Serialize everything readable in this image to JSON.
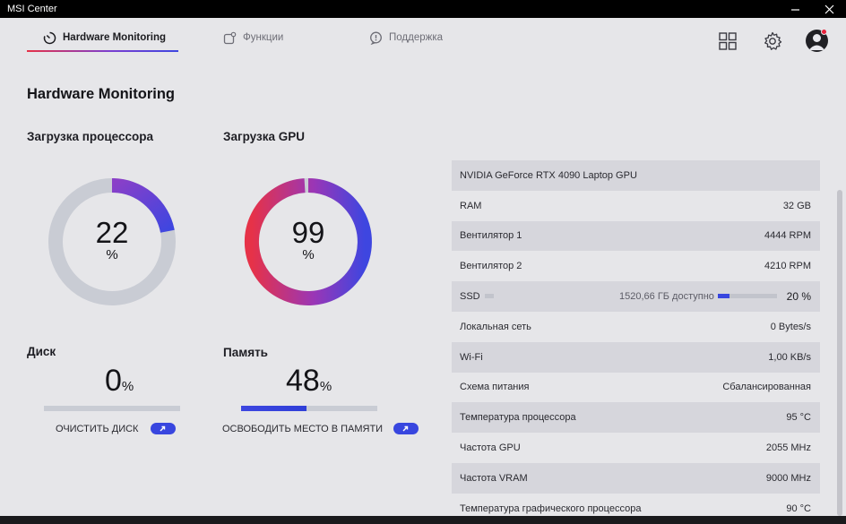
{
  "window": {
    "title": "MSI Center",
    "min_glyph": "—",
    "close_glyph": "✕"
  },
  "nav": {
    "tabs": [
      {
        "label": "Hardware Monitoring",
        "icon": "gauge-icon",
        "active": true
      },
      {
        "label": "Функции",
        "icon": "features-icon",
        "active": false
      },
      {
        "label": "Поддержка",
        "icon": "support-icon",
        "active": false
      }
    ]
  },
  "page": {
    "title": "Hardware Monitoring"
  },
  "cpu": {
    "title": "Загрузка процессора",
    "value": "22",
    "unit": "%",
    "fraction": 0.22
  },
  "gpu": {
    "title": "Загрузка GPU",
    "value": "99",
    "unit": "%",
    "fraction": 0.99
  },
  "disk": {
    "title": "Диск",
    "value": "0",
    "unit": "%",
    "fraction": 0.0,
    "action": "ОЧИСТИТЬ ДИСК"
  },
  "memory": {
    "title": "Память",
    "value": "48",
    "unit": "%",
    "fraction": 0.48,
    "action": "ОСВОБОДИТЬ МЕСТО В ПАМЯТИ"
  },
  "info": {
    "rows": [
      {
        "label": "NVIDIA GeForce RTX 4090 Laptop GPU",
        "value": ""
      },
      {
        "label": "RAM",
        "value": "32 GB"
      },
      {
        "label": "Вентилятор 1",
        "value": "4444 RPM"
      },
      {
        "label": "Вентилятор 2",
        "value": "4210 RPM"
      },
      {
        "label": "SSD",
        "value": ""
      },
      {
        "label": "Локальная сеть",
        "value": "0 Bytes/s"
      },
      {
        "label": "Wi-Fi",
        "value": "1,00 KB/s"
      },
      {
        "label": "Схема питания",
        "value": "Сбалансированная"
      },
      {
        "label": "Температура процессора",
        "value": "95 °C"
      },
      {
        "label": "Частота GPU",
        "value": "2055 MHz"
      },
      {
        "label": "Частота VRAM",
        "value": "9000 MHz"
      },
      {
        "label": "Температура графического процессора",
        "value": "90 °C"
      }
    ],
    "ssd": {
      "available": "1520,66 ГБ доступно",
      "percent": "20 %",
      "fraction": 0.2
    }
  },
  "colors": {
    "accent": "#3846df",
    "gradient_start": "#e63248",
    "gradient_mid": "#9a36b6",
    "track": "#c9ccd4"
  }
}
